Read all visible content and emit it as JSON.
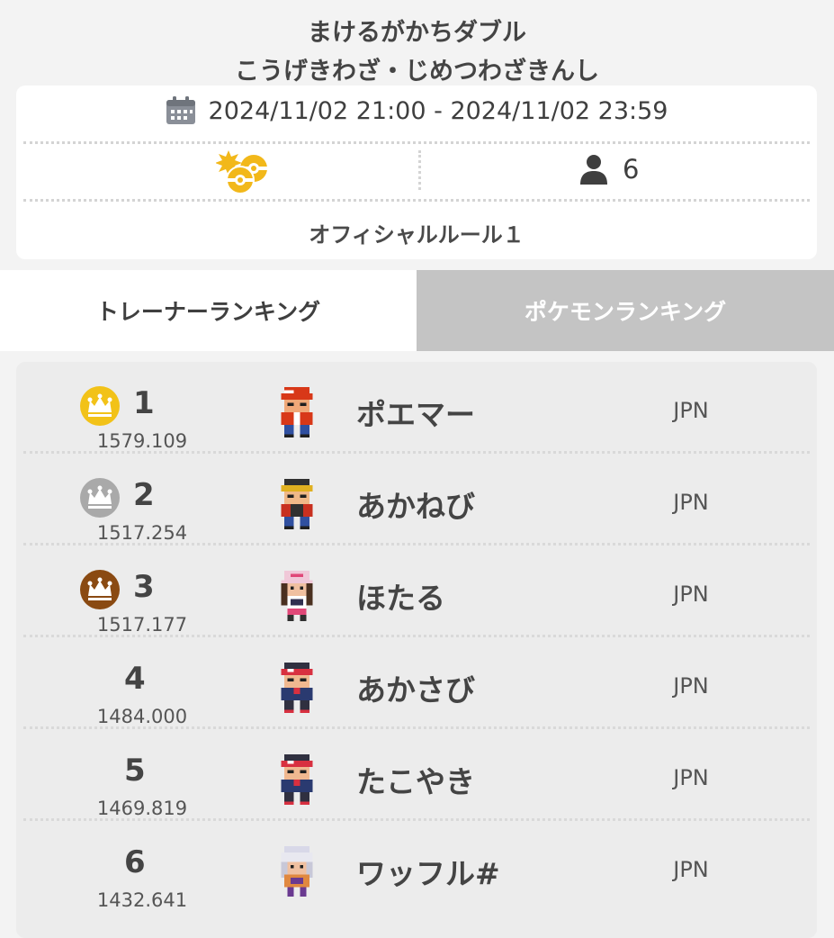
{
  "header": {
    "title_line1": "まけるがかちダブル",
    "title_line2": "こうげきわざ・じめつわざきんし"
  },
  "info": {
    "period": "2024/11/02 21:00 - 2024/11/02 23:59",
    "format_icon": "double-battle-icon",
    "player_count": "6",
    "rule": "オフィシャルルール１"
  },
  "tabs": [
    {
      "label": "トレーナーランキング",
      "active": true
    },
    {
      "label": "ポケモンランキング",
      "active": false
    }
  ],
  "ranking": [
    {
      "rank": "1",
      "rating": "1579.109",
      "name": "ポエマー",
      "country": "JPN",
      "crown": "gold",
      "sprite": "red-cap-trainer"
    },
    {
      "rank": "2",
      "rating": "1517.254",
      "name": "あかねび",
      "country": "JPN",
      "crown": "silver",
      "sprite": "gold-cap-trainer"
    },
    {
      "rank": "3",
      "rating": "1517.177",
      "name": "ほたる",
      "country": "JPN",
      "crown": "bronze",
      "sprite": "pink-hat-trainer"
    },
    {
      "rank": "4",
      "rating": "1484.000",
      "name": "あかさび",
      "country": "JPN",
      "crown": "",
      "sprite": "red-visor-trainer"
    },
    {
      "rank": "5",
      "rating": "1469.819",
      "name": "たこやき",
      "country": "JPN",
      "crown": "",
      "sprite": "red-visor-trainer"
    },
    {
      "rank": "6",
      "rating": "1432.641",
      "name": "ワッフル#",
      "country": "JPN",
      "crown": "",
      "sprite": "white-hair-trainer"
    }
  ],
  "colors": {
    "gold": "#f2c218",
    "silver": "#a9a9a9",
    "bronze": "#8a4a12",
    "inactive_tab": "#c4c4c4",
    "format_icon": "#f2b81a"
  }
}
